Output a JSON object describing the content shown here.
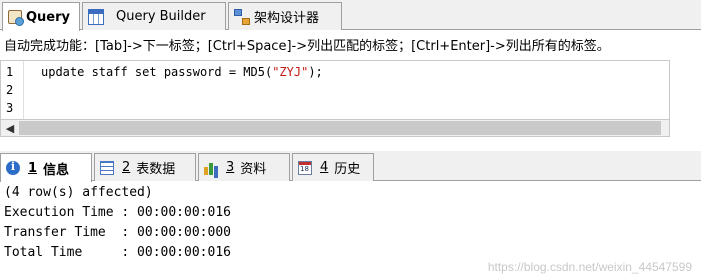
{
  "top_tabs": [
    {
      "label": "Query",
      "icon": "query-icon",
      "active": true
    },
    {
      "label": "Query Builder",
      "icon": "grid-icon",
      "active": false
    },
    {
      "label": "架构设计器",
      "icon": "schema-designer-icon",
      "active": false
    }
  ],
  "hint": "自动完成功能：[Tab]->下一标签；[Ctrl+Space]->列出匹配的标签；[Ctrl+Enter]->列出所有的标签。",
  "editor": {
    "line_numbers": [
      "1",
      "2",
      "3"
    ],
    "code_before": "update staff set password = MD5(",
    "code_string": "\"ZYJ\"",
    "code_after": ");",
    "scroll_left_arrow": "◀"
  },
  "bottom_tabs": [
    {
      "num": "1",
      "label": "信息",
      "icon": "info-icon",
      "active": true
    },
    {
      "num": "2",
      "label": "表数据",
      "icon": "table-icon",
      "active": false
    },
    {
      "num": "3",
      "label": "资料",
      "icon": "profile-icon",
      "active": false
    },
    {
      "num": "4",
      "label": "历史",
      "icon": "history-icon",
      "active": false
    }
  ],
  "output_lines": [
    "(4 row(s) affected)",
    "Execution Time : 00:00:00:016",
    "Transfer Time  : 00:00:00:000",
    "Total Time     : 00:00:00:016"
  ],
  "watermark": "https://blog.csdn.net/weixin_44547599",
  "colors": {
    "string_literal": "#c41a16",
    "tab_strip": "#f0f0f0",
    "scroll_track": "#c9c9c9"
  }
}
